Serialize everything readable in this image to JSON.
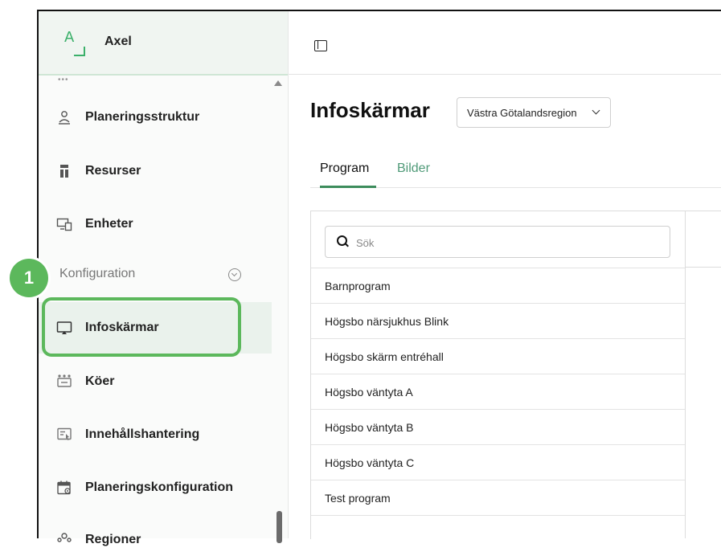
{
  "app": {
    "name": "Axel",
    "logo_letter": "A"
  },
  "sidebar": {
    "items": [
      {
        "label": "Planeringsstruktur",
        "icon": "org-structure-icon"
      },
      {
        "label": "Resurser",
        "icon": "resources-icon"
      },
      {
        "label": "Enheter",
        "icon": "devices-icon"
      }
    ],
    "section": {
      "label": "Konfiguration"
    },
    "config_items": [
      {
        "label": "Infoskärmar",
        "icon": "display-screen-icon",
        "active": true
      },
      {
        "label": "Köer",
        "icon": "queue-icon"
      },
      {
        "label": "Innehållshantering",
        "icon": "content-management-icon"
      },
      {
        "label": "Planeringskonfiguration",
        "icon": "calendar-settings-icon"
      },
      {
        "label": "Regioner",
        "icon": "regions-icon"
      }
    ],
    "callout": {
      "number": "1"
    }
  },
  "main": {
    "title": "Infoskärmar",
    "region_select": {
      "value": "Västra Götalandsregion"
    },
    "tabs": [
      {
        "label": "Program",
        "active": true
      },
      {
        "label": "Bilder",
        "active": false
      }
    ],
    "search": {
      "placeholder": "Sök"
    },
    "programs": [
      "Barnprogram",
      "Högsbo närsjukhus Blink",
      "Högsbo skärm entréhall",
      "Högsbo väntyta A",
      "Högsbo väntyta B",
      "Högsbo väntyta C",
      "Test program"
    ]
  },
  "colors": {
    "accent": "#5cb85c",
    "tab_active_underline": "#3d8c5c",
    "tab_inactive": "#4f9a78",
    "logo": "#3bb06a"
  }
}
